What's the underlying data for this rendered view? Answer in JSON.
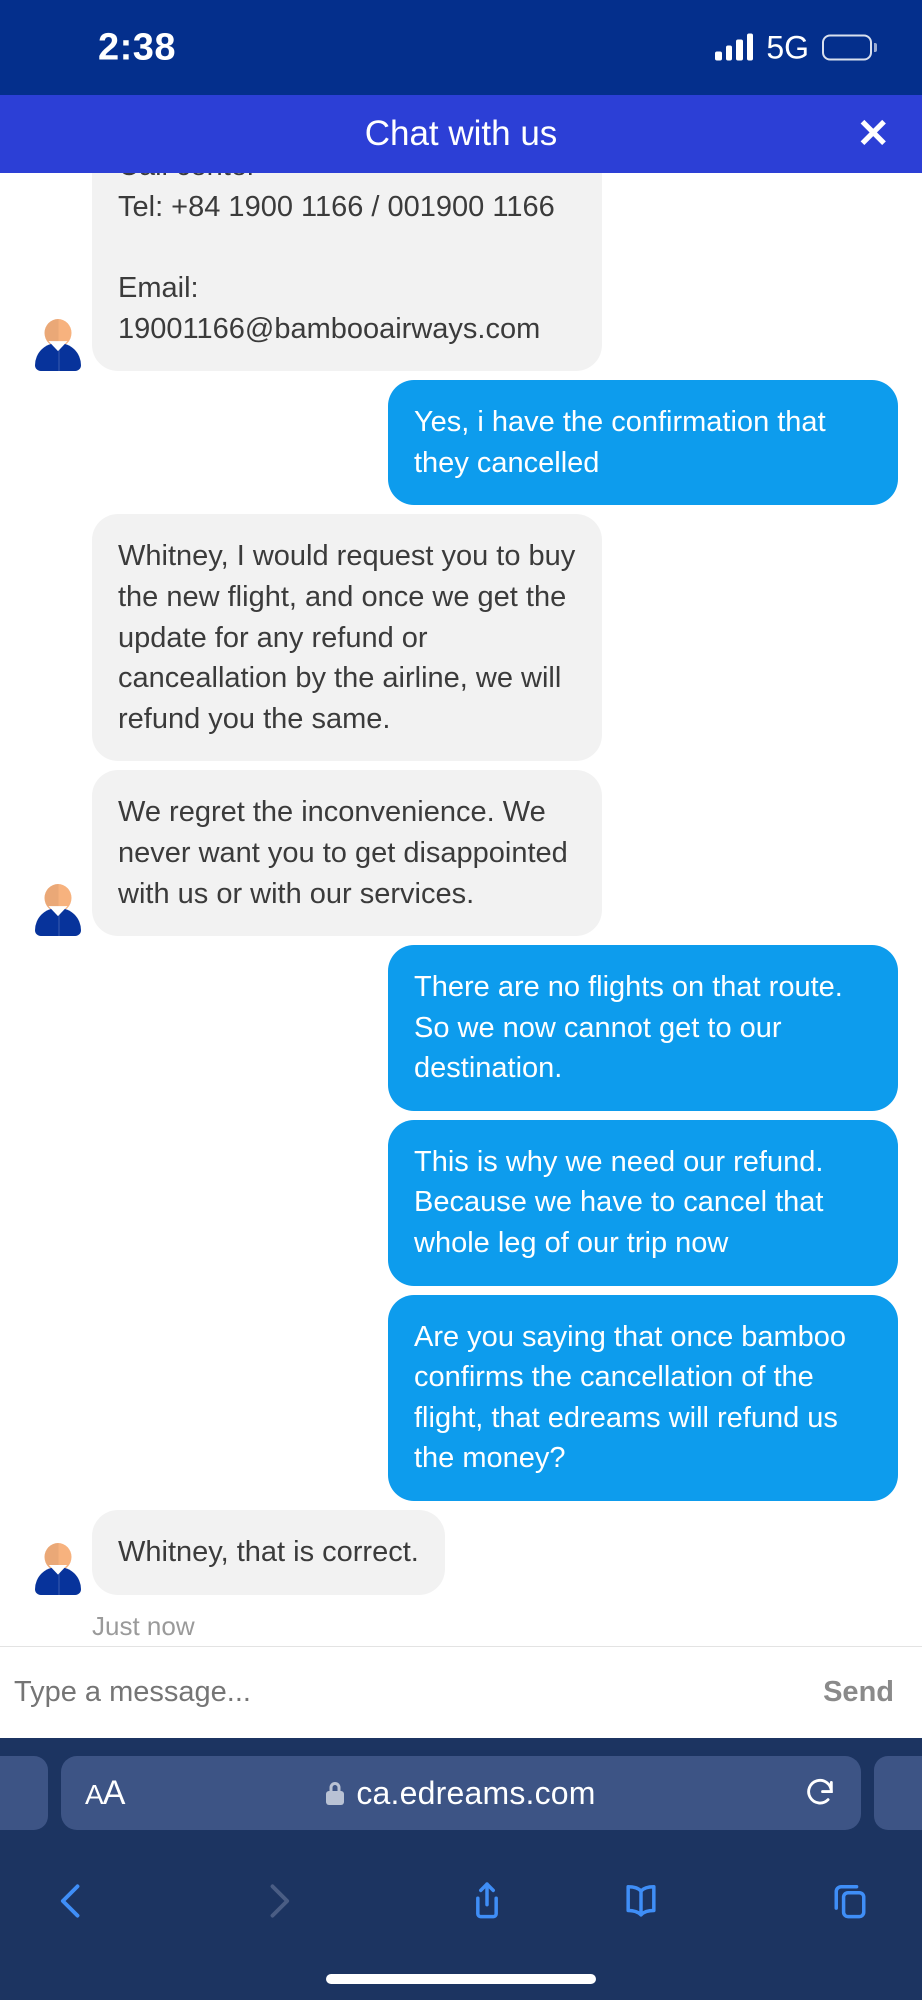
{
  "status_bar": {
    "time": "2:38",
    "network": "5G",
    "signal_icon": "signal-bars-icon",
    "battery_icon": "battery-icon",
    "background_color": "#042f8c"
  },
  "chat_header": {
    "title": "Chat with us",
    "close_label": "✕",
    "background_color": "#2c3fd6"
  },
  "conversation": {
    "agent_bubble_color": "#f2f2f2",
    "user_bubble_color": "#0d9ced",
    "messages": [
      {
        "sender": "agent",
        "text": "Village, Soc Son District, Hanoi\n\nCall center\nTel: +84 1900 1166 / 001900 1166\n\nEmail: 19001166@bambooairways.com",
        "clipped": true,
        "show_avatar": true
      },
      {
        "sender": "user",
        "text": "Yes, i have the confirmation that they cancelled",
        "clipped": false,
        "show_avatar": false
      },
      {
        "sender": "agent",
        "text": "Whitney, I would request you to buy the new flight, and once we get the update for any refund or canceallation by the airline, we will refund you the same.",
        "clipped": false,
        "show_avatar": false
      },
      {
        "sender": "agent",
        "text": "We regret the inconvenience. We never want you to get disappointed with us or with our services.",
        "clipped": false,
        "show_avatar": true
      },
      {
        "sender": "user",
        "text": "There are no flights on that route. So we now cannot get to our destination.",
        "clipped": false,
        "show_avatar": false
      },
      {
        "sender": "user",
        "text": "This is why we need our refund. Because we have to cancel that whole leg of our trip now",
        "clipped": false,
        "show_avatar": false
      },
      {
        "sender": "user",
        "text": "Are you saying that once bamboo confirms the cancellation of the flight, that edreams will refund us the money?",
        "clipped": false,
        "show_avatar": false
      },
      {
        "sender": "agent",
        "text": "Whitney, that is correct.",
        "clipped": false,
        "show_avatar": true
      }
    ],
    "timestamp": "Just now"
  },
  "composer": {
    "placeholder": "Type a message...",
    "value": "",
    "send_label": "Send"
  },
  "browser": {
    "url": "ca.edreams.com",
    "text_size_label": "AA",
    "lock_icon": "lock-icon",
    "reload_icon": "reload-icon",
    "back_icon": "chevron-left-icon",
    "forward_icon": "chevron-right-icon",
    "share_icon": "share-icon",
    "bookmarks_icon": "book-icon",
    "tabs_icon": "tabs-icon",
    "toolbar_color": "#1c3461",
    "pill_color": "#3d5485"
  }
}
